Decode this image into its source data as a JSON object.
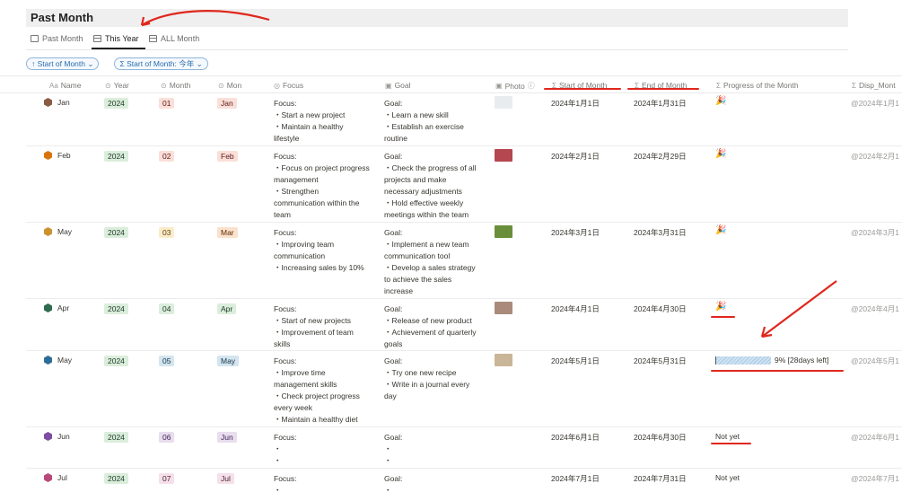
{
  "page": {
    "title": "Past Month"
  },
  "views": [
    {
      "label": "Past Month",
      "icon": "camera-icon"
    },
    {
      "label": "This Year",
      "icon": "table-icon",
      "active": true
    },
    {
      "label": "ALL Month",
      "icon": "table-icon"
    }
  ],
  "filters": [
    {
      "label": "↑ Start of Month ⌄"
    },
    {
      "label": "Σ  Start of Month: 今年 ⌄"
    }
  ],
  "columns": {
    "name": "Name",
    "year": "Year",
    "month": "Month",
    "mon": "Mon",
    "focus": "Focus",
    "goal": "Goal",
    "photo": "Photo",
    "start": "Start of Month",
    "end": "End of Month",
    "progress": "Progress of the Month",
    "disp": "Disp_Mont"
  },
  "rows": [
    {
      "name": "Jan",
      "color": "#8a5a44",
      "year": "2024",
      "month": "01",
      "mon": "Jan",
      "monthTag": {
        "bg": "#fadfd8",
        "fg": "#5d1715"
      },
      "monTag": {
        "bg": "#fadfd8",
        "fg": "#5d1715"
      },
      "focus": "Focus:\n・Start a new project\n・Maintain a healthy\nlifestyle",
      "goal": "Goal:\n・Learn a new skill\n・Establish an exercise\nroutine",
      "photo": "#e9ecef",
      "start": "2024年1月1日",
      "end": "2024年1月31日",
      "progress": "🎉",
      "disp": "@2024年1月1"
    },
    {
      "name": "Feb",
      "color": "#d9730d",
      "year": "2024",
      "month": "02",
      "mon": "Feb",
      "monthTag": {
        "bg": "#fadfd8",
        "fg": "#5d1715"
      },
      "monTag": {
        "bg": "#fadfd8",
        "fg": "#5d1715"
      },
      "focus": "Focus:\n・Focus on project progress\nmanagement\n・Strengthen\ncommunication within the\nteam",
      "goal": "Goal:\n・Check the progress of all\nprojects and make\nnecessary adjustments\n・Hold effective weekly\nmeetings within the team",
      "photo": "#b4474f",
      "start": "2024年2月1日",
      "end": "2024年2月29日",
      "progress": "🎉",
      "disp": "@2024年2月1"
    },
    {
      "name": "May",
      "color": "#cb912f",
      "year": "2024",
      "month": "03",
      "mon": "Mar",
      "monthTag": {
        "bg": "#fbecc9",
        "fg": "#5a3c0d"
      },
      "monTag": {
        "bg": "#fbe2cc",
        "fg": "#5c2a07"
      },
      "focus": "Focus:\n・Improving team\ncommunication\n・Increasing sales by 10%",
      "goal": "Goal:\n・Implement a new team\ncommunication tool\n・Develop a sales strategy\nto achieve the sales\nincrease",
      "photo": "#6a8f3a",
      "start": "2024年3月1日",
      "end": "2024年3月31日",
      "progress": "🎉",
      "disp": "@2024年3月1"
    },
    {
      "name": "Apr",
      "color": "#2f6b4f",
      "year": "2024",
      "month": "04",
      "mon": "Apr",
      "monthTag": {
        "bg": "#dbeddb",
        "fg": "#1c3829"
      },
      "monTag": {
        "bg": "#dbeddb",
        "fg": "#1c3829"
      },
      "focus": "Focus:\n・Start of new projects\n・Improvement of team\nskills",
      "goal": "Goal:\n・Release of new product\n・Achievement of quarterly\ngoals",
      "photo": "#a88b7a",
      "start": "2024年4月1日",
      "end": "2024年4月30日",
      "progress": "🎉",
      "disp": "@2024年4月1"
    },
    {
      "name": "May",
      "color": "#2d6c96",
      "year": "2024",
      "month": "05",
      "mon": "May",
      "monthTag": {
        "bg": "#d3e5ef",
        "fg": "#183347"
      },
      "monTag": {
        "bg": "#d3e5ef",
        "fg": "#183347"
      },
      "focus": "Focus:\n・Improve time\nmanagement skills\n・Check project progress\nevery week\n・Maintain a healthy diet",
      "goal": "Goal:\n・Try one new recipe\n・Write in a journal every\nday",
      "photo": "#c9b597",
      "start": "2024年5月1日",
      "end": "2024年5月31日",
      "progressBar": {
        "fraction": 0.09,
        "label": "9% [28days left]"
      },
      "disp": "@2024年5月1"
    },
    {
      "name": "Jun",
      "color": "#7d4ea3",
      "year": "2024",
      "month": "06",
      "mon": "Jun",
      "monthTag": {
        "bg": "#e8deee",
        "fg": "#412454"
      },
      "monTag": {
        "bg": "#e8deee",
        "fg": "#412454"
      },
      "focus": "Focus:\n・\n・",
      "goal": "Goal:\n・\n・",
      "start": "2024年6月1日",
      "end": "2024年6月30日",
      "progress": "Not yet",
      "disp": "@2024年6月1"
    },
    {
      "name": "Jul",
      "color": "#b8497a",
      "year": "2024",
      "month": "07",
      "mon": "Jul",
      "monthTag": {
        "bg": "#f5e0e9",
        "fg": "#4c2337"
      },
      "monTag": {
        "bg": "#f5e0e9",
        "fg": "#4c2337"
      },
      "focus": "Focus:\n・",
      "goal": "Goal:\n・",
      "start": "2024年7月1日",
      "end": "2024年7月31日",
      "progress": "Not yet",
      "disp": "@2024年7月1"
    }
  ]
}
